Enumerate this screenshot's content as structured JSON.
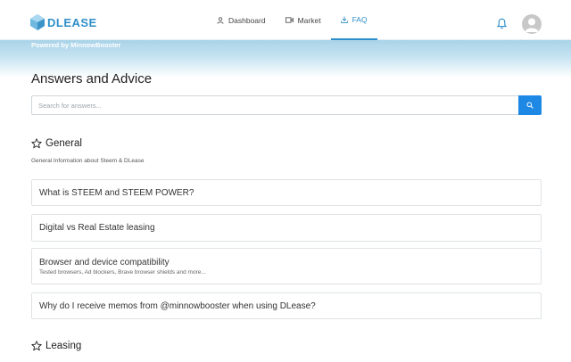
{
  "brand": {
    "name": "DLEASE",
    "accent": "#2e8ec9"
  },
  "nav": {
    "items": [
      {
        "label": "Dashboard",
        "icon": "user-icon"
      },
      {
        "label": "Market",
        "icon": "video-icon"
      },
      {
        "label": "FAQ",
        "icon": "download-icon",
        "active": true
      }
    ]
  },
  "header": {
    "notifications_icon": "bell-icon",
    "avatar_icon": "avatar-icon"
  },
  "banner": {
    "powered_by": "Powered by MinnowBooster"
  },
  "main": {
    "title": "Answers and Advice",
    "search": {
      "placeholder": "Search for answers...",
      "value": "",
      "button_icon": "search-icon",
      "button_color": "#1e88e5"
    },
    "sections": [
      {
        "title": "General",
        "icon": "star-outline-icon",
        "description": "General Information about Steem & DLease",
        "questions": [
          {
            "title": "What is STEEM and STEEM POWER?"
          },
          {
            "title": "Digital vs Real Estate leasing"
          },
          {
            "title": "Browser and device compatibility",
            "subtitle": "Tested browsers, Ad blockers, Brave browser shields and more..."
          },
          {
            "title": "Why do I receive memos from @minnowbooster when using DLease?"
          }
        ]
      },
      {
        "title": "Leasing",
        "icon": "star-outline-icon"
      }
    ]
  }
}
